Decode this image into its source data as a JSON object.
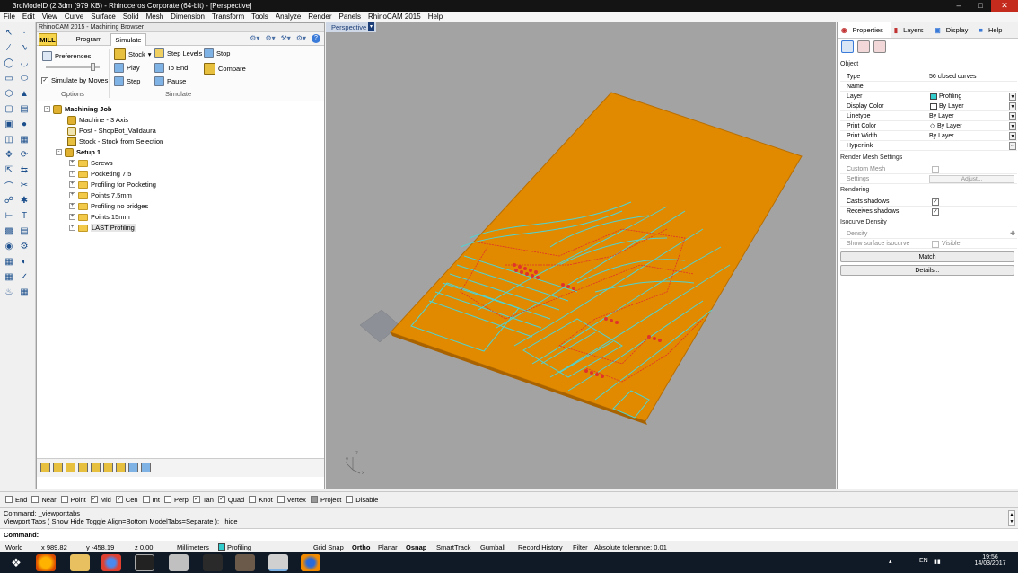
{
  "window": {
    "title": "3rdModelD (2.3dm (979 KB) - Rhinoceros Corporate (64-bit) - [Perspective]"
  },
  "menu": [
    "File",
    "Edit",
    "View",
    "Curve",
    "Surface",
    "Solid",
    "Mesh",
    "Dimension",
    "Transform",
    "Tools",
    "Analyze",
    "Render",
    "Panels",
    "RhinoCAM 2015",
    "Help"
  ],
  "browser": {
    "title": "RhinoCAM 2015 - Machining Browser",
    "tabs": {
      "mill": "MILL",
      "program": "Program",
      "simulate": "Simulate"
    },
    "options": {
      "preferences": "Preferences",
      "simulate_by_moves": "Simulate by Moves",
      "group": "Options"
    },
    "simulate": {
      "stock": "Stock",
      "play": "Play",
      "step": "Step",
      "step_levels": "Step Levels",
      "to_end": "To End",
      "pause": "Pause",
      "stop": "Stop",
      "compare": "Compare",
      "group": "Simulate"
    },
    "tree": {
      "job": "Machining Job",
      "machine": "Machine - 3 Axis",
      "post": "Post - ShopBot_Valldaura",
      "stock": "Stock - Stock from Selection",
      "setup": "Setup 1",
      "ops": [
        "Screws",
        "Pocketing 7.5",
        "Profiling for Pocketing",
        "Points 7.5mm",
        "Profiling no bridges",
        "Points 15mm",
        "LAST Profiling"
      ]
    }
  },
  "viewport": {
    "label": "Perspective",
    "axis_x": "x",
    "axis_y": "y",
    "axis_z": "z"
  },
  "properties": {
    "tabs": {
      "properties": "Properties",
      "layers": "Layers",
      "display": "Display",
      "help": "Help"
    },
    "object_header": "Object",
    "rows": {
      "type": {
        "k": "Type",
        "v": "56 closed curves"
      },
      "name": {
        "k": "Name",
        "v": ""
      },
      "layer": {
        "k": "Layer",
        "v": "Profiling"
      },
      "display_color": {
        "k": "Display Color",
        "v": "By Layer"
      },
      "linetype": {
        "k": "Linetype",
        "v": "By Layer"
      },
      "print_color": {
        "k": "Print Color",
        "v": "By Layer"
      },
      "print_width": {
        "k": "Print Width",
        "v": "By Layer"
      },
      "hyperlink": {
        "k": "Hyperlink",
        "v": ""
      }
    },
    "render_mesh": "Render Mesh Settings",
    "custom_mesh": "Custom Mesh",
    "settings": "Settings",
    "adjust": "Adjust...",
    "rendering": "Rendering",
    "casts_shadows": "Casts shadows",
    "receives_shadows": "Receives shadows",
    "isocurve": "Isocurve Density",
    "density": "Density",
    "show_surface_isocurve": "Show surface isocurve",
    "visible": "Visible",
    "match": "Match",
    "details": "Details...",
    "layer_color": "#33cccc"
  },
  "osnap": {
    "end": "End",
    "near": "Near",
    "point": "Point",
    "mid": "Mid",
    "cen": "Cen",
    "int": "Int",
    "perp": "Perp",
    "tan": "Tan",
    "quad": "Quad",
    "knot": "Knot",
    "vertex": "Vertex",
    "project": "Project",
    "disable": "Disable"
  },
  "command": {
    "history1": "Command: _viewporttabs",
    "history2": "Viewport Tabs ( Show  Hide  Toggle  Align=Bottom  ModelTabs=Separate ): _hide",
    "prompt": "Command:"
  },
  "status": {
    "cplane": "World",
    "x": "x 989.82",
    "y": "y -458.19",
    "z": "z 0.00",
    "units": "Millimeters",
    "layer": "Profiling",
    "grid_snap": "Grid Snap",
    "ortho": "Ortho",
    "planar": "Planar",
    "osnap": "Osnap",
    "smarttrack": "SmartTrack",
    "gumball": "Gumball",
    "record_history": "Record History",
    "filter": "Filter",
    "tolerance": "Absolute tolerance: 0.01"
  },
  "taskbar": {
    "lang": "EN",
    "time": "19:56",
    "date": "14/03/2017"
  },
  "colors": {
    "stock": "#e18a00",
    "toolpath": "#4fd3d3",
    "rapid": "#e0332a"
  }
}
